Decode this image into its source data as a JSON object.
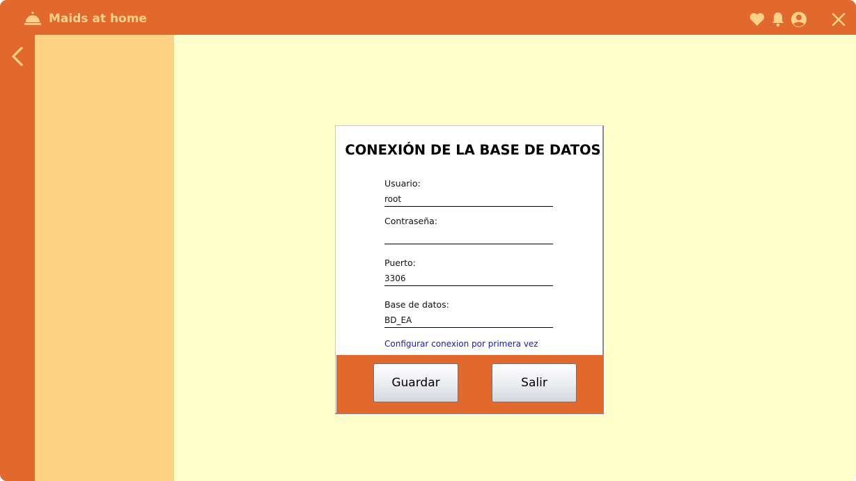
{
  "window": {
    "title": "Maids at home",
    "icons": [
      "service-bell-icon",
      "heart-icon",
      "bell-icon",
      "user-circle-icon",
      "close-icon",
      "back-arrow-icon"
    ],
    "colors": {
      "titlebar": "#e2692d",
      "sidebar": "#fed184",
      "content": "#ffffcb",
      "title_text": "#fdd18a"
    }
  },
  "dialog": {
    "title": "CONEXIÓN DE LA BASE DE DATOS",
    "fields": {
      "usuario": {
        "label": "Usuario:",
        "value": "root"
      },
      "password": {
        "label": "Contraseña:",
        "value": ""
      },
      "puerto": {
        "label": "Puerto:",
        "value": "3306"
      },
      "base_datos": {
        "label": "Base de datos:",
        "value": "BD_EA"
      }
    },
    "link": "Configurar conexion por primera vez",
    "buttons": {
      "save": "Guardar",
      "exit": "Salir"
    }
  }
}
